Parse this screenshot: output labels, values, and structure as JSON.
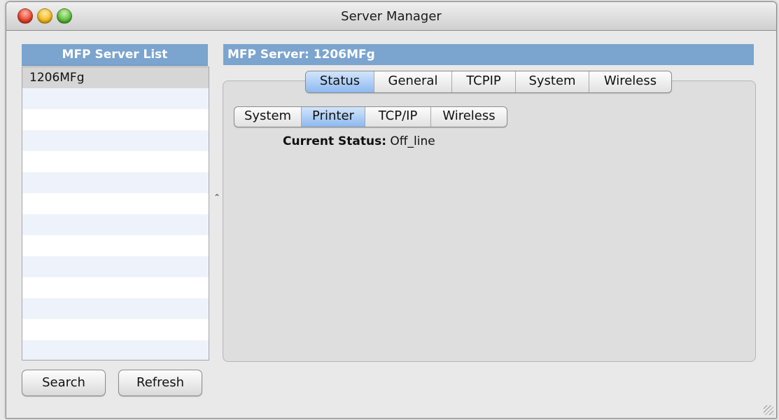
{
  "window": {
    "title": "Server Manager"
  },
  "server_list": {
    "header": "MFP Server List",
    "items": [
      "1206MFg"
    ],
    "selected_index": 0
  },
  "buttons": {
    "search": "Search",
    "refresh": "Refresh"
  },
  "server_panel": {
    "header": "MFP Server: 1206MFg",
    "tabs": [
      "Status",
      "General",
      "TCPIP",
      "System",
      "Wireless"
    ],
    "active_tab": "Status",
    "subtabs": [
      "System",
      "Printer",
      "TCP/IP",
      "Wireless"
    ],
    "active_subtab": "Printer",
    "status_label": "Current Status:",
    "status_value": "Off_line"
  },
  "colors": {
    "header_bg": "#7ba4cf",
    "selected_tab": "#8db9ef"
  }
}
